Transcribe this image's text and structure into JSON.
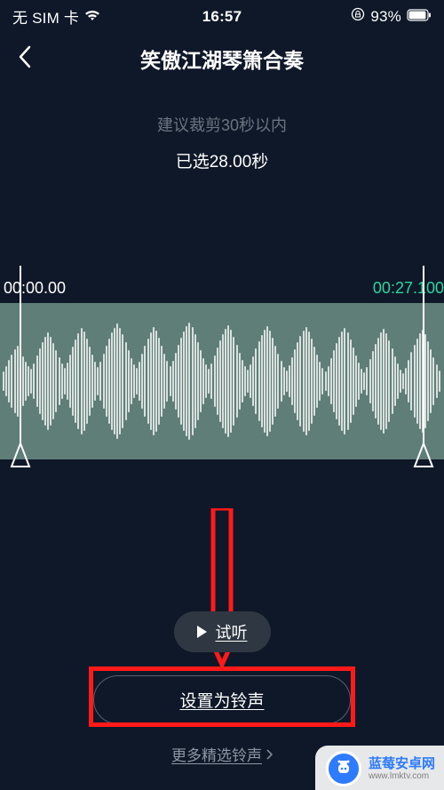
{
  "status": {
    "carrier": "无 SIM 卡",
    "time": "16:57",
    "battery_pct": "93%"
  },
  "nav": {
    "title": "笑傲江湖琴箫合奏"
  },
  "info": {
    "hint": "建议裁剪30秒以内",
    "selected_prefix": "已选",
    "selected_value": "28.00",
    "selected_unit": "秒"
  },
  "wave": {
    "start_ts": "00:00.00",
    "end_ts": "00:27.100"
  },
  "buttons": {
    "play_label": "试听",
    "set_label": "设置为铃声",
    "more_label": "更多精选铃声"
  },
  "watermark": {
    "brand_line1": "蓝莓安卓网",
    "brand_line2": "www.lmktv.com"
  }
}
